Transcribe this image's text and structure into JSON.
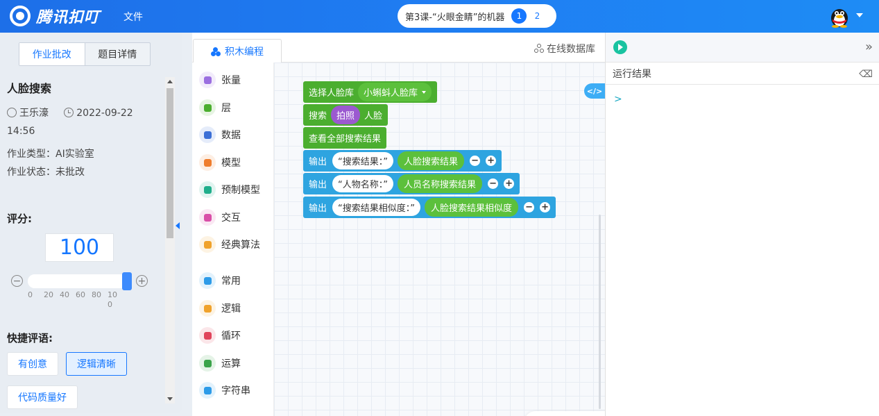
{
  "header": {
    "logo_text": "腾讯扣叮",
    "menu_file": "文件",
    "lesson_title": "第3课-“火眼金睛”的机器",
    "steps": [
      "1",
      "2"
    ]
  },
  "left": {
    "tabs": [
      "作业批改",
      "题目详情"
    ],
    "task_title": "人脸搜索",
    "student": "王乐濠",
    "datetime": "2022-09-22 14:56",
    "type_label": "作业类型：AI实验室",
    "status_label": "作业状态：未批改",
    "score_label": "评分:",
    "score_value": "100",
    "slider": {
      "min": 0,
      "max": 100,
      "value": 100,
      "ticks": [
        "0",
        "20",
        "40",
        "60",
        "80",
        "100"
      ]
    },
    "quick_label": "快捷评语:",
    "quick_comments": [
      "有创意",
      "逻辑清晰",
      "代码质量好"
    ]
  },
  "editor": {
    "tab_label": "积木编程",
    "db_link": "在线数据库",
    "palette": [
      {
        "label": "张量",
        "icon": "grid-icon",
        "color": "#9b6fe0"
      },
      {
        "label": "层",
        "icon": "layers-icon",
        "color": "#4bae2f"
      },
      {
        "label": "数据",
        "icon": "swap-icon",
        "color": "#3b6fd6"
      },
      {
        "label": "模型",
        "icon": "cube-icon",
        "color": "#ef7d2d"
      },
      {
        "label": "预制模型",
        "icon": "cube-outline-icon",
        "color": "#1fae8b"
      },
      {
        "label": "交互",
        "icon": "person-icon",
        "color": "#d94fa8"
      },
      {
        "label": "经典算法",
        "icon": "algorithm-icon",
        "color": "#f0a22b"
      },
      {
        "label": "常用",
        "icon": "square-icon",
        "color": "#2d9be8"
      },
      {
        "label": "逻辑",
        "icon": "logic-icon",
        "color": "#f0a22b"
      },
      {
        "label": "循环",
        "icon": "loop-icon",
        "color": "#e0445b"
      },
      {
        "label": "运算",
        "icon": "calc-icon",
        "color": "#3aa34a"
      },
      {
        "label": "字符串",
        "icon": "text-icon",
        "color": "#2d9be8"
      }
    ],
    "blocks": {
      "b1_label": "选择人脸库",
      "b1_dropdown": "小蝌蚪人脸库",
      "b2_label": "搜索",
      "b2_pill": "拍照",
      "b2_tail": "人脸",
      "b3_label": "查看全部搜索结果",
      "out_label": "输出",
      "out1_text": "“搜索结果：”",
      "out1_value": "人脸搜索结果",
      "out2_text": "“人物名称：”",
      "out2_value": "人员名称搜索结果",
      "out3_text": "“搜索结果相似度：”",
      "out3_value": "人脸搜索结果相似度",
      "minus": "−",
      "plus": "+"
    },
    "code_toggle": "</>"
  },
  "right": {
    "result_label": "运行结果",
    "prompt": ">"
  }
}
